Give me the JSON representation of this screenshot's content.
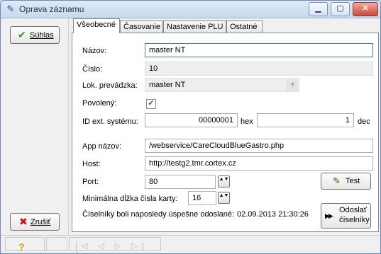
{
  "window": {
    "title": "Oprava záznamu",
    "icon": "edit-pencil-icon",
    "controls": {
      "minimize": "▁",
      "maximize": "▢",
      "close": "✕"
    }
  },
  "sidebar": {
    "ok_button": {
      "label": "Súhlas",
      "icon": "checkmark-icon",
      "icon_glyph": "✔",
      "icon_color": "#2e9a2e"
    },
    "cancel_button": {
      "label": "Zrušiť",
      "icon": "red-x-icon",
      "icon_glyph": "✖",
      "icon_color": "#c01818"
    }
  },
  "tabs": [
    "Všeobecné",
    "Časovanie",
    "Nastavenie PLU",
    "Ostatné"
  ],
  "active_tab": "Všeobecné",
  "form": {
    "name_label": "Názov:",
    "name_value": "master NT",
    "number_label": "Číslo:",
    "number_value": "10",
    "location_label": "Lok. prevádzka:",
    "location_value": "master NT",
    "enabled_label": "Povolený:",
    "enabled_checked": true,
    "enabled_mark": "✓",
    "ext_id_label": "ID ext. systému:",
    "ext_id_hex_value": "00000001",
    "hex_label": "hex",
    "ext_id_dec_value": "1",
    "dec_label": "dec",
    "app_name_label": "App názov:",
    "app_name_value": "/webservice/CareCloudBlueGastro.php",
    "host_label": "Host:",
    "host_value": "http://testg2.tmr.cortex.cz",
    "port_label": "Port:",
    "port_value": "80",
    "min_card_label": "Minimálna dĺžka čísla karty:",
    "min_card_value": "16",
    "last_sent_label": "Číselníky boli naposledy úspešne odoslané:",
    "last_sent_value": "02.09.2013 21:30:26",
    "spin_glyph": "▲▼"
  },
  "buttons": {
    "test": {
      "label": "Test",
      "icon": "pencil-icon",
      "icon_glyph": "✎"
    },
    "send": {
      "label_line1": "Odoslať",
      "label_line2": "číselníky",
      "icon": "fast-forward-icon",
      "icon_glyph": "▶▶"
    }
  },
  "statusbar": {
    "help_glyph": "?",
    "nav_glyphs": "|◁ ◁ ▷ ▷| ↻"
  }
}
